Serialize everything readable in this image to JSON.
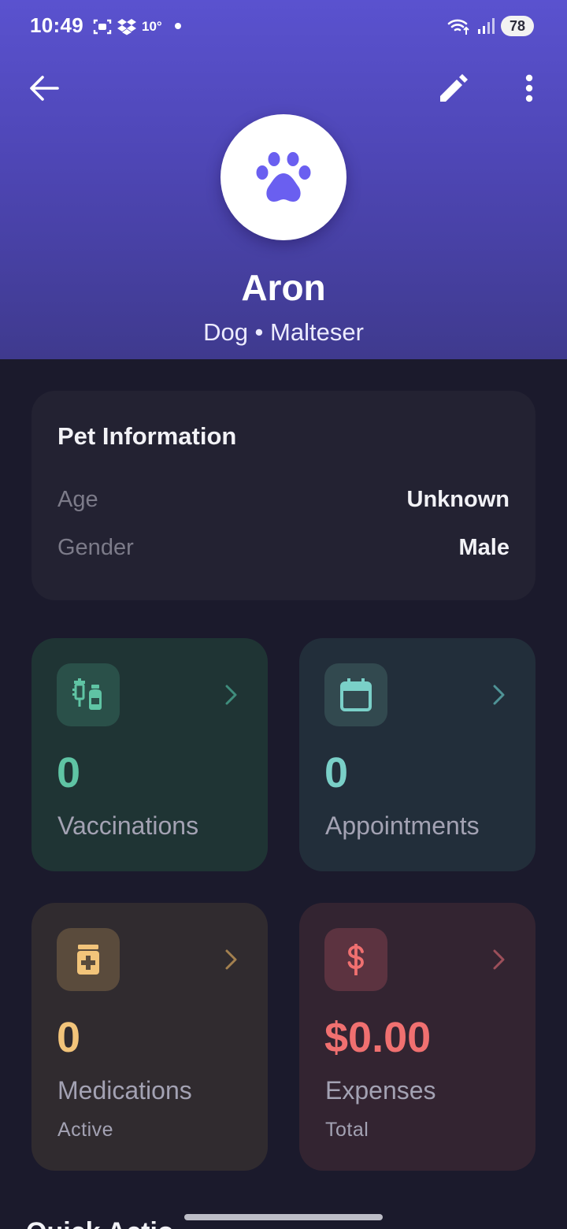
{
  "status_bar": {
    "time": "10:49",
    "temperature": "10°",
    "battery": "78"
  },
  "app_bar": {
    "back_icon": "arrow-back-icon",
    "edit_icon": "pencil-icon",
    "more_icon": "more-vert-icon"
  },
  "pet": {
    "avatar_icon": "paw-icon",
    "name": "Aron",
    "subtitle": "Dog • Malteser"
  },
  "info_card": {
    "title": "Pet Information",
    "rows": [
      {
        "label": "Age",
        "value": "Unknown"
      },
      {
        "label": "Gender",
        "value": "Male"
      }
    ]
  },
  "stats": [
    {
      "icon": "syringe-vial-icon",
      "value": "0",
      "label": "Vaccinations",
      "sub": "",
      "accent": "#5fc4a4"
    },
    {
      "icon": "calendar-icon",
      "value": "0",
      "label": "Appointments",
      "sub": "",
      "accent": "#7ad0c8"
    },
    {
      "icon": "medicine-bottle-icon",
      "value": "0",
      "label": "Medications",
      "sub": "Active",
      "accent": "#f2c47a"
    },
    {
      "icon": "dollar-icon",
      "value": "$0.00",
      "label": "Expenses",
      "sub": "Total",
      "accent": "#f07070"
    }
  ],
  "section": {
    "title_partial": "Quick Actio"
  },
  "colors": {
    "header_top": "#5a52cf",
    "header_bottom": "#3f3a8e",
    "background": "#1b1a2c",
    "card": "#232232",
    "paw": "#6a5ff0"
  }
}
